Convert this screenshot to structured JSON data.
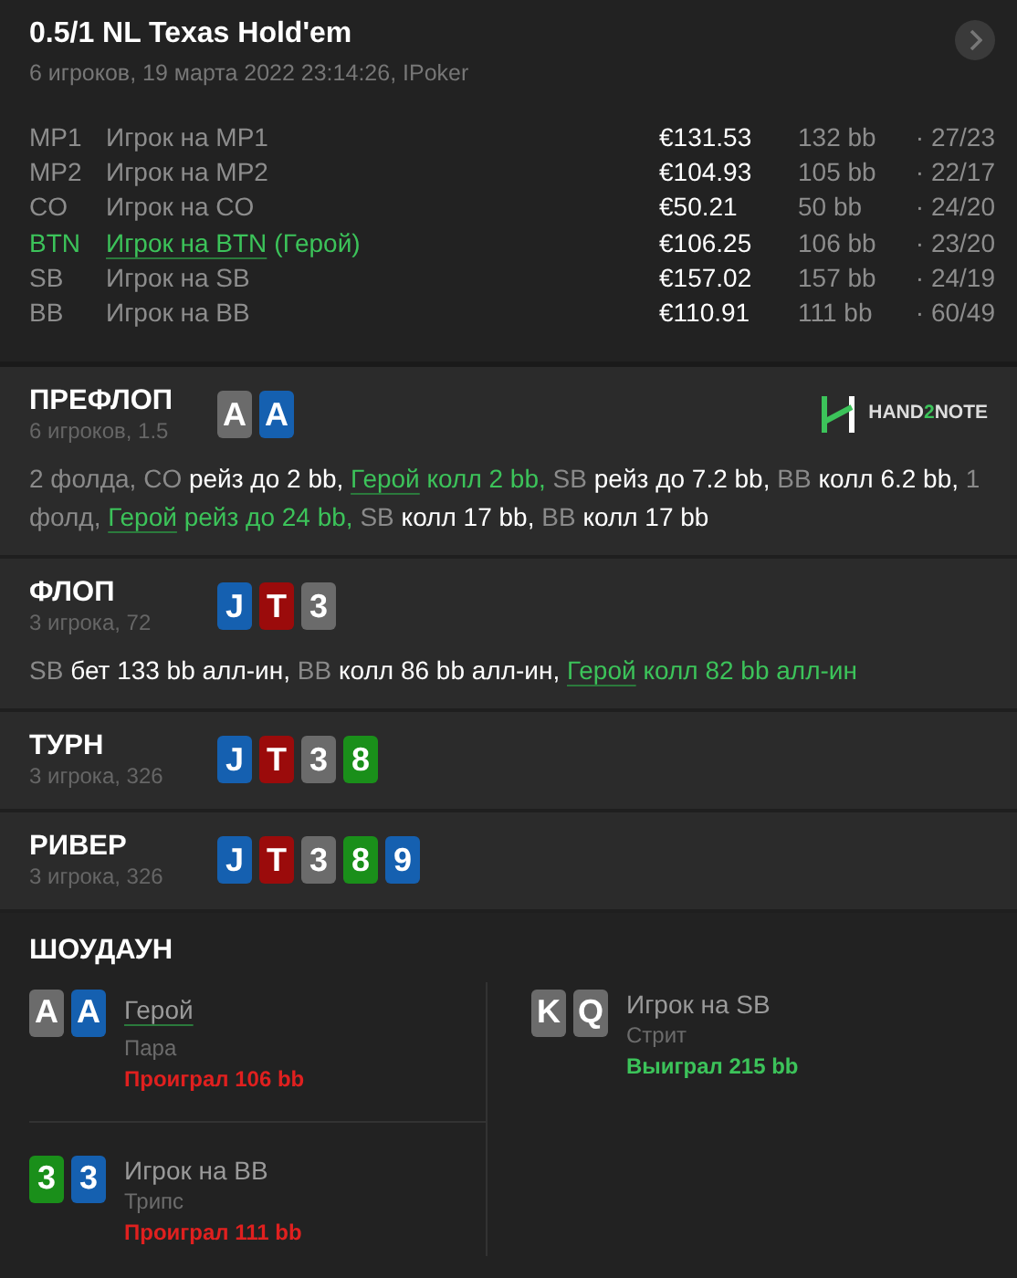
{
  "header": {
    "title": "0.5/1 NL Texas Hold'em",
    "subtitle": "6 игроков, 19 марта 2022 23:14:26, IPoker"
  },
  "players": [
    {
      "position": "MP1",
      "name": "Игрок на MP1",
      "hero": false,
      "stack": "€131.53",
      "bb": "132 bb",
      "stats": "· 27/23"
    },
    {
      "position": "MP2",
      "name": "Игрок на MP2",
      "hero": false,
      "stack": "€104.93",
      "bb": "105 bb",
      "stats": "· 22/17"
    },
    {
      "position": "CO",
      "name": "Игрок на CO",
      "hero": false,
      "stack": "€50.21",
      "bb": "50 bb",
      "stats": "· 24/20"
    },
    {
      "position": "BTN",
      "name": "Игрок на BTN",
      "hero": true,
      "hero_tag": "(Герой)",
      "stack": "€106.25",
      "bb": "106 bb",
      "stats": "· 23/20"
    },
    {
      "position": "SB",
      "name": "Игрок на SB",
      "hero": false,
      "stack": "€157.02",
      "bb": "157 bb",
      "stats": "· 24/19"
    },
    {
      "position": "BB",
      "name": "Игрок на BB",
      "hero": false,
      "stack": "€110.91",
      "bb": "111 bb",
      "stats": "· 60/49"
    }
  ],
  "logo": [
    {
      "text": "HAND",
      "accent": false
    },
    {
      "text": "2",
      "accent": true
    },
    {
      "text": "NOTE",
      "accent": false
    }
  ],
  "streets": [
    {
      "name": "ПРЕФЛОП",
      "info": "6 игроков, 1.5",
      "cards": [
        {
          "rank": "A",
          "color": "#6b6b6b"
        },
        {
          "rank": "A",
          "color": "#1560b0"
        }
      ],
      "actions": [
        {
          "kind": "note",
          "text": "2 фолда,"
        },
        {
          "kind": "actor",
          "text": "CO"
        },
        {
          "kind": "move",
          "text": "рейз до 2 bb,"
        },
        {
          "kind": "hero",
          "text": "Герой"
        },
        {
          "kind": "hero_move",
          "text": "колл 2 bb,"
        },
        {
          "kind": "actor",
          "text": "SB"
        },
        {
          "kind": "move",
          "text": "рейз до 7.2 bb,"
        },
        {
          "kind": "actor",
          "text": "BB"
        },
        {
          "kind": "move",
          "text": "колл 6.2 bb,"
        },
        {
          "kind": "note",
          "text": "1 фолд,"
        },
        {
          "kind": "hero",
          "text": "Герой"
        },
        {
          "kind": "hero_move",
          "text": "рейз до 24 bb,"
        },
        {
          "kind": "actor",
          "text": "SB"
        },
        {
          "kind": "move",
          "text": "колл 17 bb,"
        },
        {
          "kind": "actor",
          "text": "BB"
        },
        {
          "kind": "move",
          "text": "колл 17 bb"
        }
      ]
    },
    {
      "name": "ФЛОП",
      "info": "3 игрока, 72",
      "cards": [
        {
          "rank": "J",
          "color": "#1560b0"
        },
        {
          "rank": "T",
          "color": "#9b0b0b"
        },
        {
          "rank": "3",
          "color": "#6b6b6b"
        }
      ],
      "actions": [
        {
          "kind": "actor",
          "text": "SB"
        },
        {
          "kind": "move",
          "text": "бет 133 bb алл-ин,"
        },
        {
          "kind": "actor",
          "text": "BB"
        },
        {
          "kind": "move",
          "text": "колл 86 bb алл-ин,"
        },
        {
          "kind": "hero",
          "text": "Герой"
        },
        {
          "kind": "hero_move",
          "text": "колл 82 bb алл-ин"
        }
      ]
    },
    {
      "name": "ТУРН",
      "info": "3 игрока, 326",
      "cards": [
        {
          "rank": "J",
          "color": "#1560b0"
        },
        {
          "rank": "T",
          "color": "#9b0b0b"
        },
        {
          "rank": "3",
          "color": "#6b6b6b"
        },
        {
          "rank": "8",
          "color": "#1a8f1a"
        }
      ]
    },
    {
      "name": "РИВЕР",
      "info": "3 игрока, 326",
      "cards": [
        {
          "rank": "J",
          "color": "#1560b0"
        },
        {
          "rank": "T",
          "color": "#9b0b0b"
        },
        {
          "rank": "3",
          "color": "#6b6b6b"
        },
        {
          "rank": "8",
          "color": "#1a8f1a"
        },
        {
          "rank": "9",
          "color": "#1560b0"
        }
      ]
    }
  ],
  "showdown": {
    "title": "ШОУДАУН",
    "columns": [
      [
        {
          "cards": [
            {
              "rank": "A",
              "color": "#6b6b6b"
            },
            {
              "rank": "A",
              "color": "#1560b0"
            }
          ],
          "name": "Герой",
          "hero": true,
          "hand": "Пара",
          "result": "Проиграл 106 bb",
          "won": false
        },
        {
          "cards": [
            {
              "rank": "3",
              "color": "#1a8f1a"
            },
            {
              "rank": "3",
              "color": "#1560b0"
            }
          ],
          "name": "Игрок на BB",
          "hero": false,
          "hand": "Трипс",
          "result": "Проиграл 111 bb",
          "won": false
        }
      ],
      [
        {
          "cards": [
            {
              "rank": "K",
              "color": "#6b6b6b"
            },
            {
              "rank": "Q",
              "color": "#6b6b6b"
            }
          ],
          "name": "Игрок на SB",
          "hero": false,
          "hand": "Стрит",
          "result": "Выиграл 215 bb",
          "won": true
        }
      ]
    ]
  }
}
